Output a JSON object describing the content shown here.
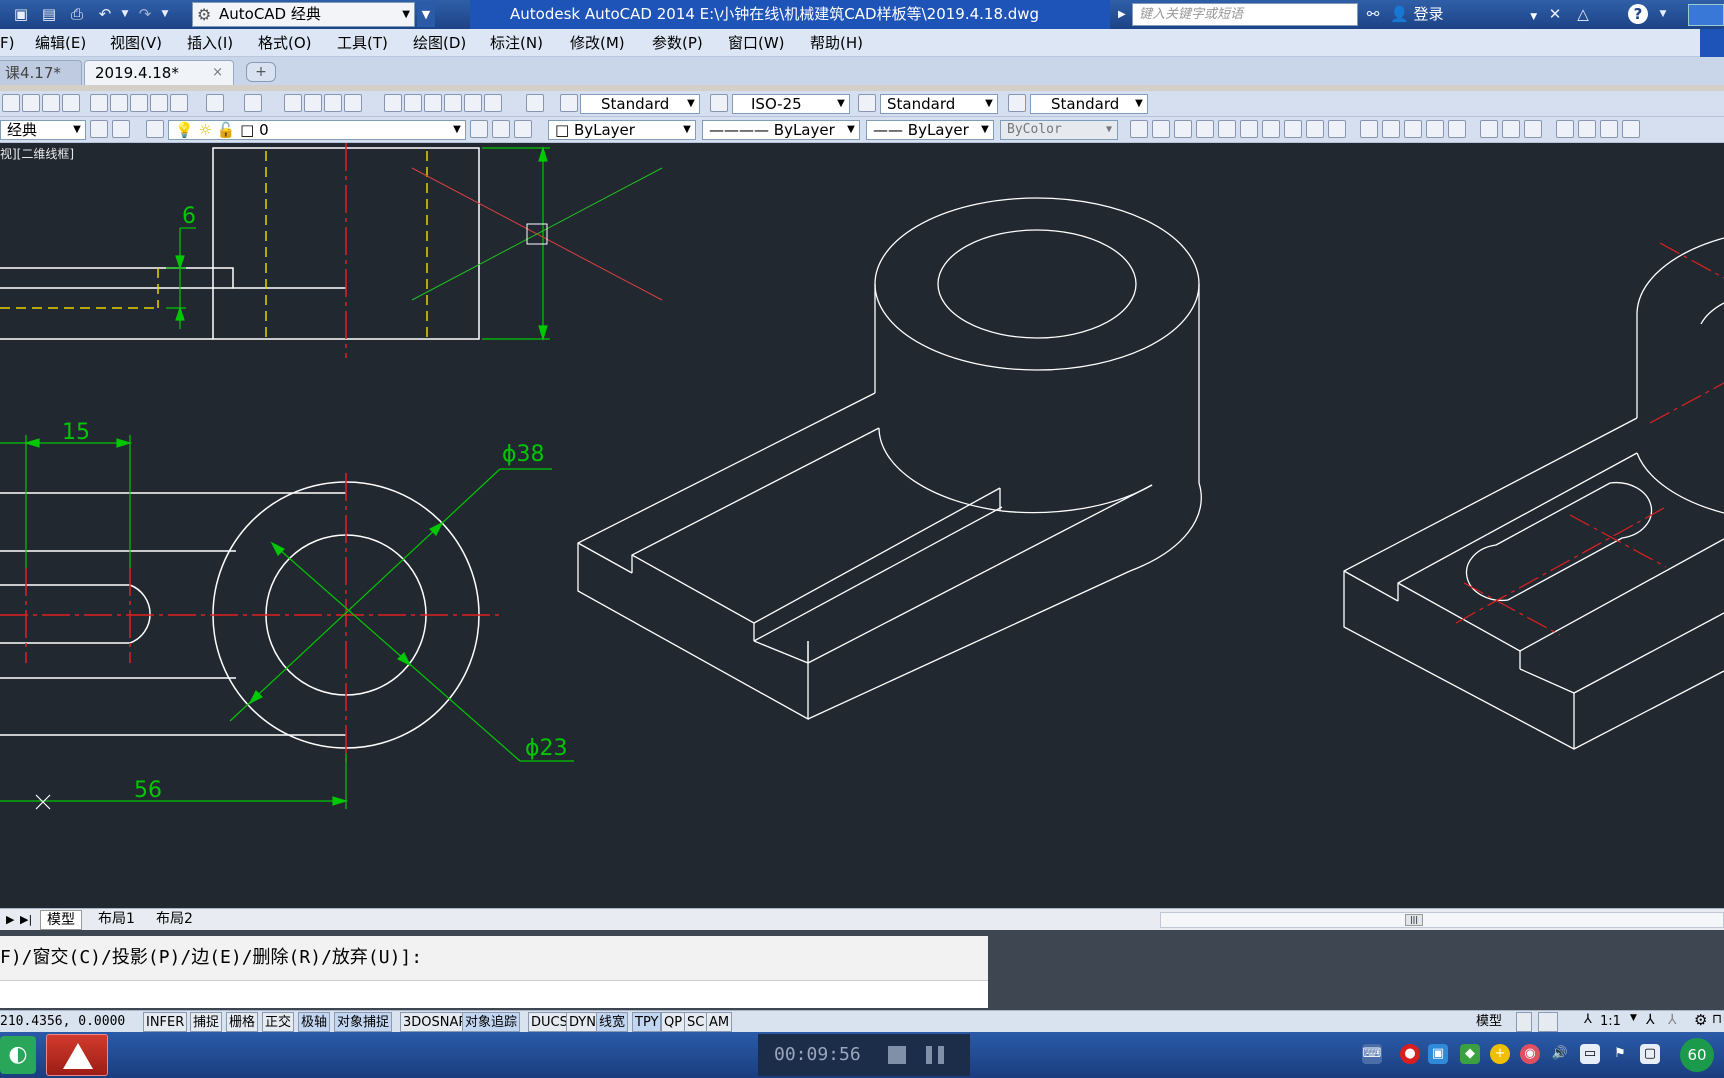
{
  "titlebar": {
    "workspace": "AutoCAD 经典",
    "app_title": "Autodesk AutoCAD 2014    E:\\小钟在线\\机械建筑CAD样板等\\2019.4.18.dwg",
    "search_placeholder": "键入关键字或短语",
    "login_label": "登录"
  },
  "menu": {
    "items": [
      "F)",
      "编辑(E)",
      "视图(V)",
      "插入(I)",
      "格式(O)",
      "工具(T)",
      "绘图(D)",
      "标注(N)",
      "修改(M)",
      "参数(P)",
      "窗口(W)",
      "帮助(H)"
    ]
  },
  "tabs": {
    "old": "课4.17*",
    "current": "2019.4.18*",
    "close": "×",
    "new": "+"
  },
  "toolbar1": {
    "text_style": "Standard",
    "dim_style": "ISO-25",
    "table_style": "Standard",
    "mleader_style": "Standard"
  },
  "toolbar2": {
    "workspace_short": "经典",
    "layer": "0",
    "color": "ByLayer",
    "linetype": "ByLayer",
    "lineweight": "ByLayer",
    "plotstyle": "ByColor"
  },
  "canvas": {
    "view_label": "视][二维线框]",
    "dims": {
      "d6": "6",
      "d15": "15",
      "d38": "ϕ38",
      "d23": "ϕ23",
      "d56": "56"
    }
  },
  "layout_tabs": [
    "模型",
    "布局1",
    "布局2"
  ],
  "command": {
    "history": "F)/窗交(C)/投影(P)/边(E)/删除(R)/放弃(U)]:",
    "input": ""
  },
  "status": {
    "coords": "210.4356, 0.0000",
    "buttons": [
      {
        "label": "INFER",
        "on": false
      },
      {
        "label": "捕捉",
        "on": false
      },
      {
        "label": "栅格",
        "on": false
      },
      {
        "label": "正交",
        "on": false
      },
      {
        "label": "极轴",
        "on": true
      },
      {
        "label": "对象捕捉",
        "on": true
      },
      {
        "label": "3DOSNAP",
        "on": false
      },
      {
        "label": "对象追踪",
        "on": true
      },
      {
        "label": "DUCS",
        "on": false
      },
      {
        "label": "DYN",
        "on": false
      },
      {
        "label": "线宽",
        "on": true
      },
      {
        "label": "TPY",
        "on": true
      },
      {
        "label": "QP",
        "on": false
      },
      {
        "label": "SC",
        "on": false
      },
      {
        "label": "AM",
        "on": false
      }
    ],
    "model_label": "模型",
    "scale": "1:1"
  },
  "taskbar": {
    "recorder_time": "00:09:56",
    "badge": "60"
  },
  "colors": {
    "canvas_bg": "#212830",
    "geometry": "#ffffff",
    "dimension": "#00c800",
    "centerline": "#e02020",
    "hidden": "#e6d200"
  }
}
